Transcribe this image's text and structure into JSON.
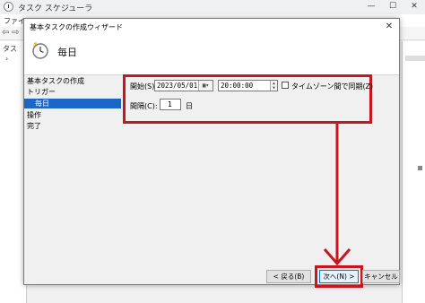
{
  "app": {
    "title": "タスク スケジューラ",
    "menu": "ファイル",
    "tree_item": "タス",
    "controls": {
      "minimize": "—",
      "maximize": "☐",
      "close": "✕"
    }
  },
  "dialog": {
    "title": "基本タスクの作成ウィザード",
    "heading": "毎日",
    "close": "✕",
    "steps": [
      {
        "label": "基本タスクの作成"
      },
      {
        "label": "トリガー"
      },
      {
        "label": "毎日"
      },
      {
        "label": "操作"
      },
      {
        "label": "完了"
      }
    ],
    "start_label": "開始(S):",
    "start_date": "2023/05/01",
    "start_time": "20:00:00",
    "sync_label": "タイムゾーン間で同期(Z)",
    "sync_checked": false,
    "interval_label": "間隔(C):",
    "interval_value": "1",
    "interval_unit": "日",
    "buttons": {
      "back": "< 戻る(B)",
      "next": "次へ(N) >",
      "cancel": "キャンセル"
    }
  },
  "colors": {
    "highlight": "#c9151e",
    "selected_step": "#1c66c8"
  }
}
